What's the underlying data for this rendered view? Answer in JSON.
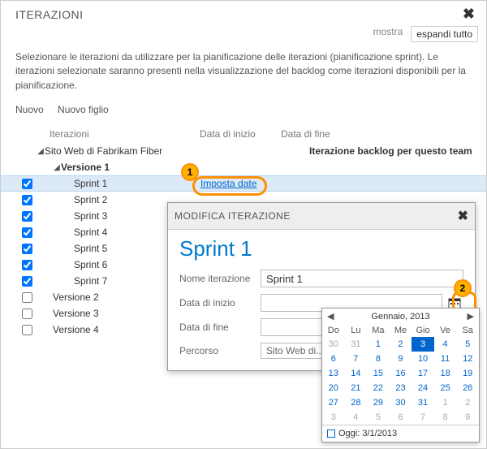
{
  "header": {
    "title": "ITERAZIONI"
  },
  "toplinks": {
    "show": "mostra",
    "expand": "espandi tutto"
  },
  "description": "Selezionare le iterazioni da utilizzare per la pianificazione delle iterazioni (pianificazione sprint). Le iterazioni selezionate saranno presenti nella visualizzazione del backlog come iterazioni disponibili per la pianificazione.",
  "commands": {
    "new": "Nuovo",
    "newchild": "Nuovo figlio"
  },
  "columns": {
    "iter": "Iterazioni",
    "start": "Data di inizio",
    "end": "Data di fine"
  },
  "team_note": "Iterazione backlog per questo team",
  "tree": {
    "root": "Sito Web di Fabrikam Fiber",
    "v1": "Versione 1",
    "sprints": [
      "Sprint 1",
      "Sprint 2",
      "Sprint 3",
      "Sprint 4",
      "Sprint 5",
      "Sprint 6",
      "Sprint 7"
    ],
    "v2": "Versione 2",
    "v3": "Versione 3",
    "v4": "Versione 4"
  },
  "set_dates_label": "Imposta date",
  "annotations": {
    "a1": "1",
    "a2": "2"
  },
  "popup": {
    "title": "MODIFICA ITERAZIONE",
    "big": "Sprint 1",
    "name_label": "Nome iterazione",
    "name_value": "Sprint 1",
    "start_label": "Data di inizio",
    "end_label": "Data di fine",
    "path_label": "Percorso",
    "path_value": "Sito Web di..."
  },
  "calendar": {
    "month": "Gennaio, 2013",
    "dow": [
      "Do",
      "Lu",
      "Ma",
      "Me",
      "Gio",
      "Ve",
      "Sa"
    ],
    "today_label": "Oggi: 3/1/2013",
    "weeks": [
      [
        {
          "d": "30",
          "off": true
        },
        {
          "d": "31",
          "off": true
        },
        {
          "d": "1"
        },
        {
          "d": "2"
        },
        {
          "d": "3",
          "sel": true
        },
        {
          "d": "4"
        },
        {
          "d": "5"
        }
      ],
      [
        {
          "d": "6"
        },
        {
          "d": "7"
        },
        {
          "d": "8"
        },
        {
          "d": "9"
        },
        {
          "d": "10"
        },
        {
          "d": "11"
        },
        {
          "d": "12"
        }
      ],
      [
        {
          "d": "13"
        },
        {
          "d": "14"
        },
        {
          "d": "15"
        },
        {
          "d": "16"
        },
        {
          "d": "17"
        },
        {
          "d": "18"
        },
        {
          "d": "19"
        }
      ],
      [
        {
          "d": "20"
        },
        {
          "d": "21"
        },
        {
          "d": "22"
        },
        {
          "d": "23"
        },
        {
          "d": "24"
        },
        {
          "d": "25"
        },
        {
          "d": "26"
        }
      ],
      [
        {
          "d": "27"
        },
        {
          "d": "28"
        },
        {
          "d": "29"
        },
        {
          "d": "30"
        },
        {
          "d": "31"
        },
        {
          "d": "1",
          "off": true
        },
        {
          "d": "2",
          "off": true
        }
      ],
      [
        {
          "d": "3",
          "off": true
        },
        {
          "d": "4",
          "off": true
        },
        {
          "d": "5",
          "off": true
        },
        {
          "d": "6",
          "off": true
        },
        {
          "d": "7",
          "off": true
        },
        {
          "d": "8",
          "off": true
        },
        {
          "d": "9",
          "off": true
        }
      ]
    ]
  }
}
